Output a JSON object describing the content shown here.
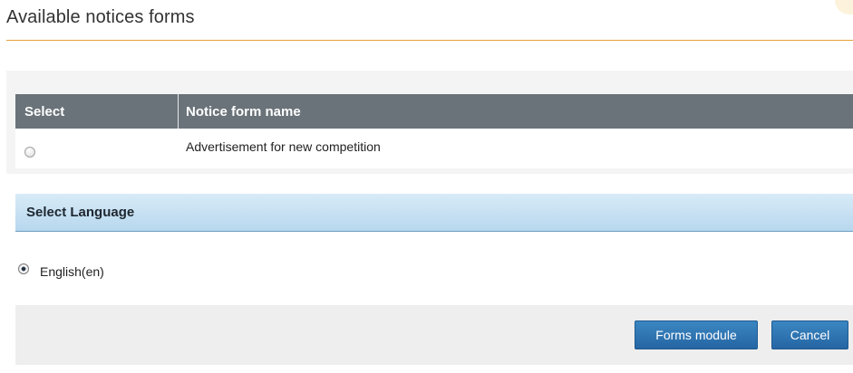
{
  "page": {
    "title": "Available notices forms"
  },
  "forms_table": {
    "headers": {
      "select": "Select",
      "name": "Notice form name"
    },
    "rows": [
      {
        "name": "Advertisement for new competition",
        "selected": false
      }
    ]
  },
  "language": {
    "header": "Select Language",
    "options": [
      {
        "label": "English(en)",
        "selected": true
      }
    ]
  },
  "actions": {
    "forms_module": "Forms module",
    "cancel": "Cancel"
  },
  "colors": {
    "accent_rule": "#e6a23a",
    "table_header": "#6a737a",
    "lang_header": "#b7d7ee",
    "button": "#2f74b5"
  }
}
